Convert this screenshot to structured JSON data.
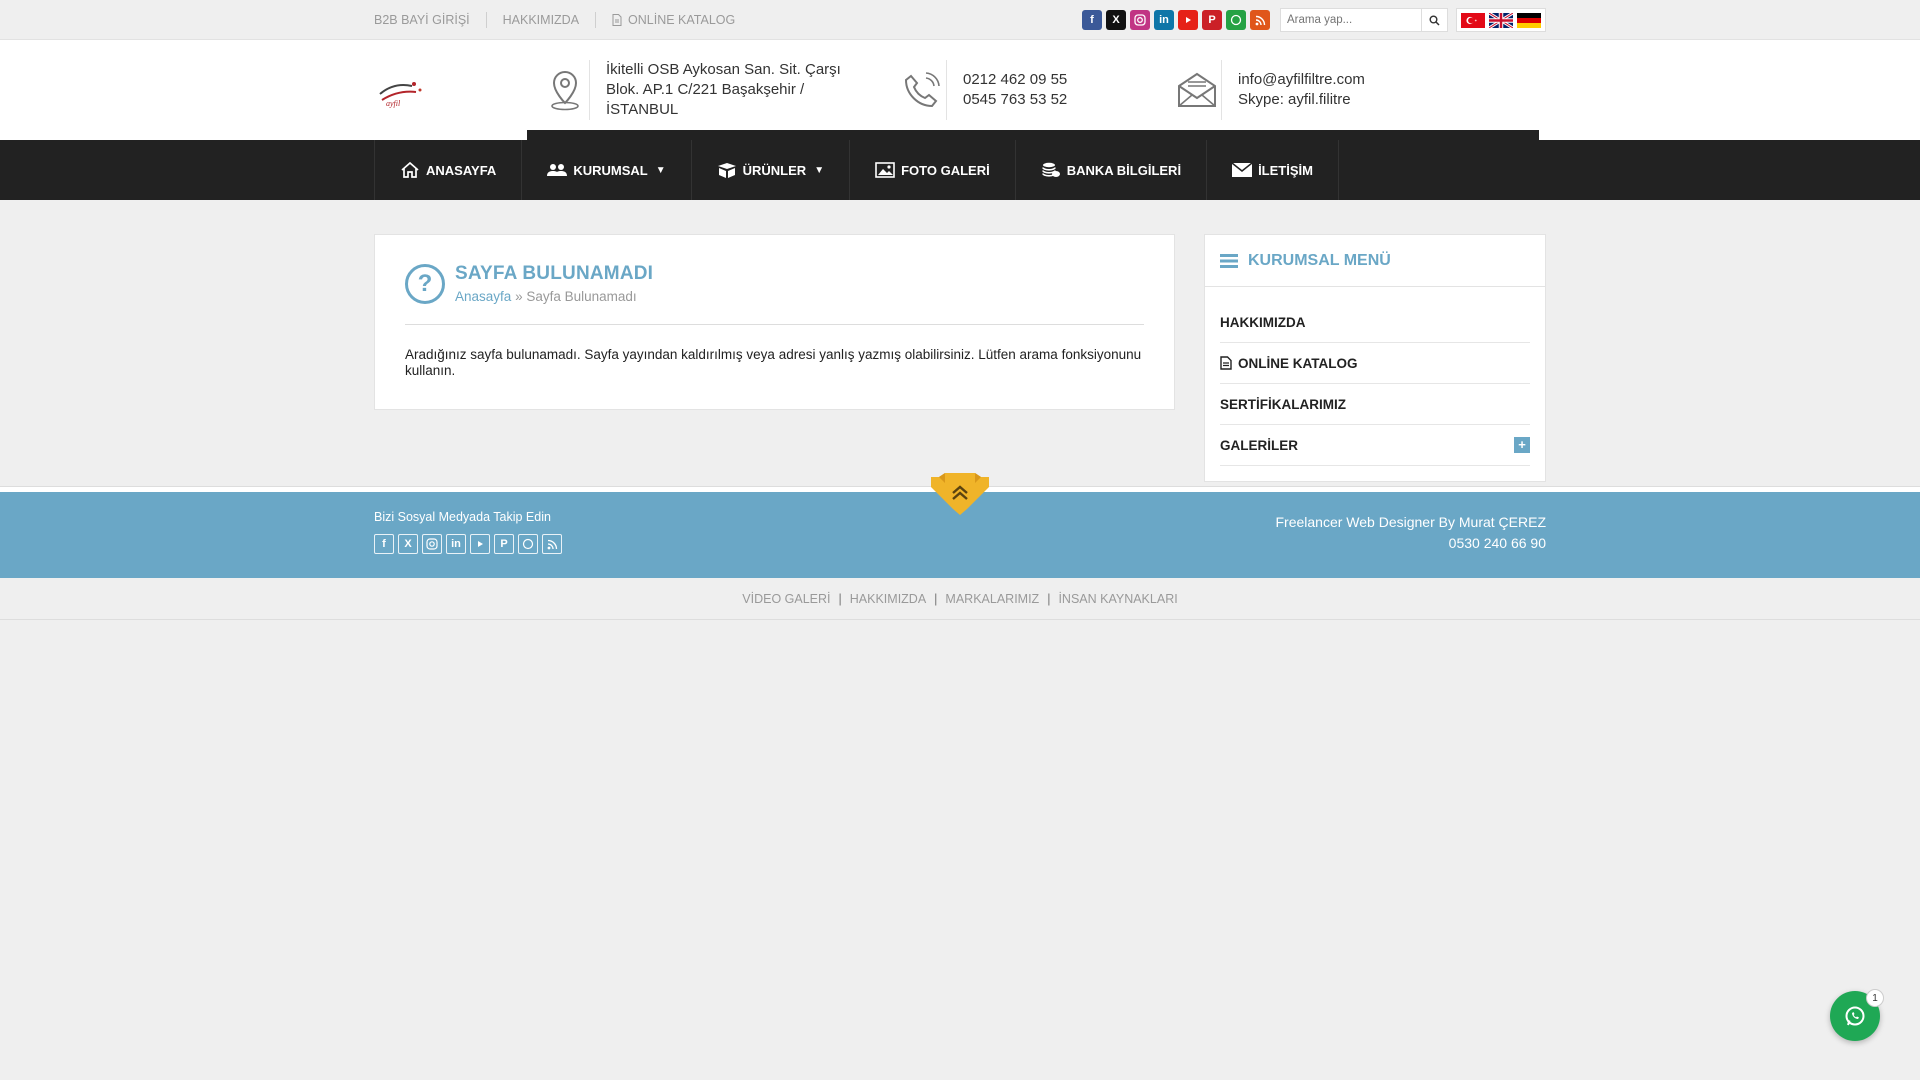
{
  "topbar": {
    "links": [
      {
        "label": "B2B BAYİ GİRİŞİ"
      },
      {
        "label": "HAKKIMIZDA"
      },
      {
        "label": "ONLİNE KATALOG"
      }
    ],
    "social": [
      {
        "icon": "facebook-icon",
        "color": "#3b5998"
      },
      {
        "icon": "x-twitter-icon",
        "color": "#111111"
      },
      {
        "icon": "instagram-icon",
        "color": "#c13584"
      },
      {
        "icon": "linkedin-icon",
        "color": "#0e76a8"
      },
      {
        "icon": "youtube-icon",
        "color": "#e62117"
      },
      {
        "icon": "pinterest-icon",
        "color": "#cb2027"
      },
      {
        "icon": "whatsapp-icon",
        "color": "#25a244"
      },
      {
        "icon": "rss-icon",
        "color": "#e0561b"
      }
    ],
    "search_placeholder": "Arama yap...",
    "languages": [
      "tr",
      "en",
      "de"
    ]
  },
  "header": {
    "address": [
      "İkitelli OSB Aykosan San. Sit. Çarşı",
      "Blok. AP.1 C/221 Başakşehir /",
      "İSTANBUL"
    ],
    "phones": [
      "0212 462 09 55",
      "0545 763 53 52"
    ],
    "email": "info@ayfilfiltre.com",
    "skype": "Skype: ayfil.filitre"
  },
  "nav": [
    {
      "label": "ANASAYFA",
      "icon": "home-icon"
    },
    {
      "label": "KURUMSAL",
      "icon": "users-icon",
      "dropdown": true
    },
    {
      "label": "ÜRÜNLER",
      "icon": "box-icon",
      "dropdown": true
    },
    {
      "label": "FOTO GALERİ",
      "icon": "image-icon"
    },
    {
      "label": "BANKA BİLGİLERİ",
      "icon": "coins-icon"
    },
    {
      "label": "İLETİŞİM",
      "icon": "mail-icon"
    }
  ],
  "page": {
    "title": "SAYFA BULUNAMADI",
    "breadcrumb_home": "Anasayfa",
    "breadcrumb_sep": "»",
    "breadcrumb_current": "Sayfa Bulunamadı",
    "message": "Aradığınız sayfa bulunamadı. Sayfa yayından kaldırılmış veya adresi yanlış yazmış olabilirsiniz. Lütfen arama fonksiyonunu kullanın."
  },
  "sidebar": {
    "title": "KURUMSAL MENÜ",
    "items": [
      {
        "label": "HAKKIMIZDA"
      },
      {
        "label": "ONLİNE KATALOG"
      },
      {
        "label": "SERTİFİKALARIMIZ"
      },
      {
        "label": "GALERİLER",
        "expandable": true
      }
    ]
  },
  "footer": {
    "follow_text": "Bizi Sosyal Medyada Takip Edin",
    "credit_line": "Freelancer Web Designer By Murat ÇEREZ",
    "credit_phone": "0530 240 66 90",
    "links": [
      "VİDEO GALERİ",
      "HAKKIMIZDA",
      "MARKALARIMIZ",
      "İNSAN KAYNAKLARI"
    ],
    "link_sep": "|"
  },
  "whatsapp_float": {
    "badge": "1",
    "color": "#1fa855"
  },
  "colors": {
    "accent": "#6aa7c6",
    "nav_bg": "#222222",
    "scroll_top": "#f0b429"
  }
}
